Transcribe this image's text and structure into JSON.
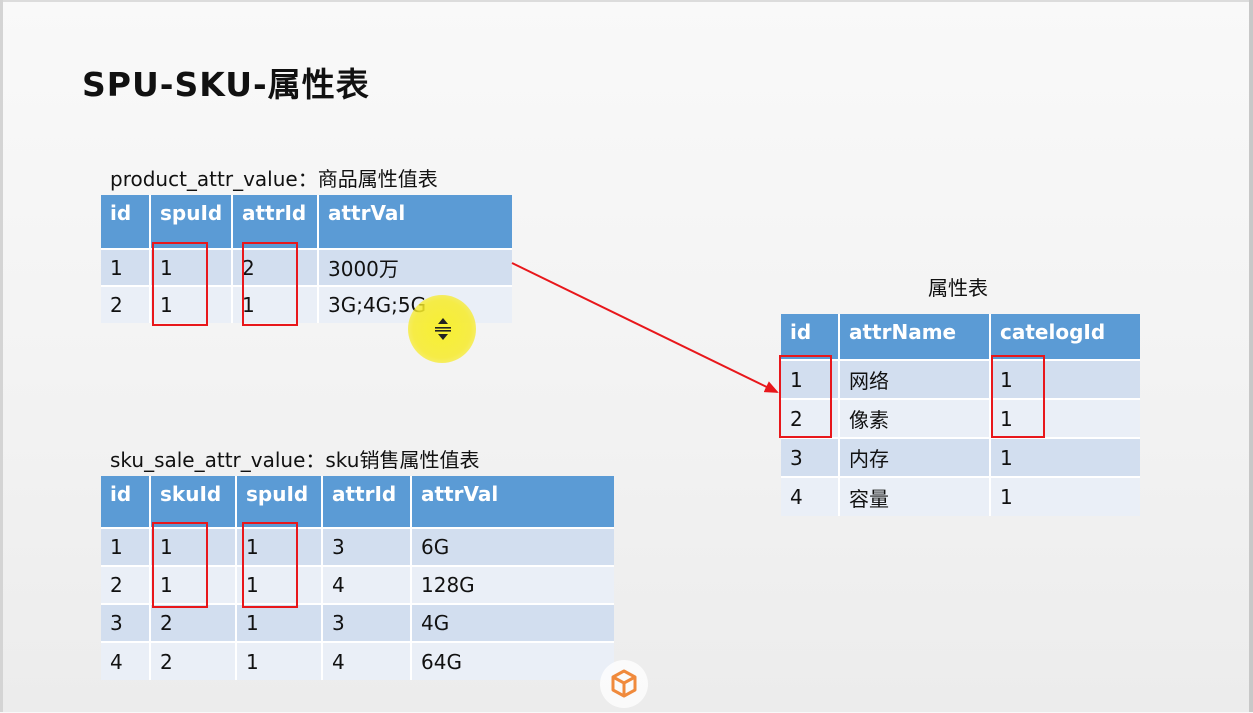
{
  "title": "SPU-SKU-属性表",
  "product_table": {
    "caption": "product_attr_value：商品属性值表",
    "headers": [
      "id",
      "spuId",
      "attrId",
      "attrVal"
    ],
    "rows": [
      [
        "1",
        "1",
        "2",
        "3000万"
      ],
      [
        "2",
        "1",
        "1",
        "3G;4G;5G"
      ]
    ]
  },
  "sku_table": {
    "caption": "sku_sale_attr_value：sku销售属性值表",
    "headers": [
      "id",
      "skuId",
      "spuId",
      "attrId",
      "attrVal"
    ],
    "rows": [
      [
        "1",
        "1",
        "1",
        "3",
        "6G"
      ],
      [
        "2",
        "1",
        "1",
        "4",
        "128G"
      ],
      [
        "3",
        "2",
        "1",
        "3",
        "4G"
      ],
      [
        "4",
        "2",
        "1",
        "4",
        "64G"
      ]
    ]
  },
  "attr_table": {
    "caption": "属性表",
    "headers": [
      "id",
      "attrName",
      "catelogId"
    ],
    "rows": [
      [
        "1",
        "网络",
        "1"
      ],
      [
        "2",
        "像素",
        "1"
      ],
      [
        "3",
        "内存",
        "1"
      ],
      [
        "4",
        "容量",
        "1"
      ]
    ]
  },
  "colors": {
    "header": "#5b9bd5",
    "row_odd": "#d2deef",
    "row_even": "#eaeff7",
    "highlight": "#e8171b",
    "cursor_halo": "#f7ef28",
    "watermark": "#f08a3c"
  },
  "icons": [
    "resize-vertical-icon",
    "watermark-logo-icon"
  ]
}
